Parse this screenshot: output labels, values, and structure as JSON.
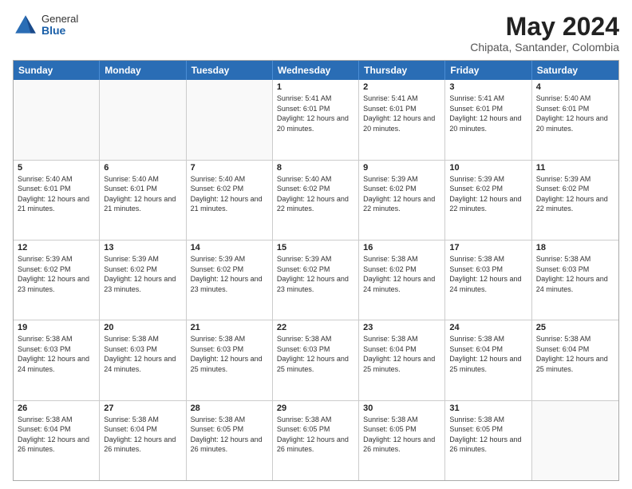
{
  "logo": {
    "general": "General",
    "blue": "Blue"
  },
  "title": "May 2024",
  "location": "Chipata, Santander, Colombia",
  "days_of_week": [
    "Sunday",
    "Monday",
    "Tuesday",
    "Wednesday",
    "Thursday",
    "Friday",
    "Saturday"
  ],
  "weeks": [
    [
      {
        "day": "",
        "sunrise": "",
        "sunset": "",
        "daylight": "",
        "empty": true
      },
      {
        "day": "",
        "sunrise": "",
        "sunset": "",
        "daylight": "",
        "empty": true
      },
      {
        "day": "",
        "sunrise": "",
        "sunset": "",
        "daylight": "",
        "empty": true
      },
      {
        "day": "1",
        "sunrise": "Sunrise: 5:41 AM",
        "sunset": "Sunset: 6:01 PM",
        "daylight": "Daylight: 12 hours and 20 minutes.",
        "empty": false
      },
      {
        "day": "2",
        "sunrise": "Sunrise: 5:41 AM",
        "sunset": "Sunset: 6:01 PM",
        "daylight": "Daylight: 12 hours and 20 minutes.",
        "empty": false
      },
      {
        "day": "3",
        "sunrise": "Sunrise: 5:41 AM",
        "sunset": "Sunset: 6:01 PM",
        "daylight": "Daylight: 12 hours and 20 minutes.",
        "empty": false
      },
      {
        "day": "4",
        "sunrise": "Sunrise: 5:40 AM",
        "sunset": "Sunset: 6:01 PM",
        "daylight": "Daylight: 12 hours and 20 minutes.",
        "empty": false
      }
    ],
    [
      {
        "day": "5",
        "sunrise": "Sunrise: 5:40 AM",
        "sunset": "Sunset: 6:01 PM",
        "daylight": "Daylight: 12 hours and 21 minutes.",
        "empty": false
      },
      {
        "day": "6",
        "sunrise": "Sunrise: 5:40 AM",
        "sunset": "Sunset: 6:01 PM",
        "daylight": "Daylight: 12 hours and 21 minutes.",
        "empty": false
      },
      {
        "day": "7",
        "sunrise": "Sunrise: 5:40 AM",
        "sunset": "Sunset: 6:02 PM",
        "daylight": "Daylight: 12 hours and 21 minutes.",
        "empty": false
      },
      {
        "day": "8",
        "sunrise": "Sunrise: 5:40 AM",
        "sunset": "Sunset: 6:02 PM",
        "daylight": "Daylight: 12 hours and 22 minutes.",
        "empty": false
      },
      {
        "day": "9",
        "sunrise": "Sunrise: 5:39 AM",
        "sunset": "Sunset: 6:02 PM",
        "daylight": "Daylight: 12 hours and 22 minutes.",
        "empty": false
      },
      {
        "day": "10",
        "sunrise": "Sunrise: 5:39 AM",
        "sunset": "Sunset: 6:02 PM",
        "daylight": "Daylight: 12 hours and 22 minutes.",
        "empty": false
      },
      {
        "day": "11",
        "sunrise": "Sunrise: 5:39 AM",
        "sunset": "Sunset: 6:02 PM",
        "daylight": "Daylight: 12 hours and 22 minutes.",
        "empty": false
      }
    ],
    [
      {
        "day": "12",
        "sunrise": "Sunrise: 5:39 AM",
        "sunset": "Sunset: 6:02 PM",
        "daylight": "Daylight: 12 hours and 23 minutes.",
        "empty": false
      },
      {
        "day": "13",
        "sunrise": "Sunrise: 5:39 AM",
        "sunset": "Sunset: 6:02 PM",
        "daylight": "Daylight: 12 hours and 23 minutes.",
        "empty": false
      },
      {
        "day": "14",
        "sunrise": "Sunrise: 5:39 AM",
        "sunset": "Sunset: 6:02 PM",
        "daylight": "Daylight: 12 hours and 23 minutes.",
        "empty": false
      },
      {
        "day": "15",
        "sunrise": "Sunrise: 5:39 AM",
        "sunset": "Sunset: 6:02 PM",
        "daylight": "Daylight: 12 hours and 23 minutes.",
        "empty": false
      },
      {
        "day": "16",
        "sunrise": "Sunrise: 5:38 AM",
        "sunset": "Sunset: 6:02 PM",
        "daylight": "Daylight: 12 hours and 24 minutes.",
        "empty": false
      },
      {
        "day": "17",
        "sunrise": "Sunrise: 5:38 AM",
        "sunset": "Sunset: 6:03 PM",
        "daylight": "Daylight: 12 hours and 24 minutes.",
        "empty": false
      },
      {
        "day": "18",
        "sunrise": "Sunrise: 5:38 AM",
        "sunset": "Sunset: 6:03 PM",
        "daylight": "Daylight: 12 hours and 24 minutes.",
        "empty": false
      }
    ],
    [
      {
        "day": "19",
        "sunrise": "Sunrise: 5:38 AM",
        "sunset": "Sunset: 6:03 PM",
        "daylight": "Daylight: 12 hours and 24 minutes.",
        "empty": false
      },
      {
        "day": "20",
        "sunrise": "Sunrise: 5:38 AM",
        "sunset": "Sunset: 6:03 PM",
        "daylight": "Daylight: 12 hours and 24 minutes.",
        "empty": false
      },
      {
        "day": "21",
        "sunrise": "Sunrise: 5:38 AM",
        "sunset": "Sunset: 6:03 PM",
        "daylight": "Daylight: 12 hours and 25 minutes.",
        "empty": false
      },
      {
        "day": "22",
        "sunrise": "Sunrise: 5:38 AM",
        "sunset": "Sunset: 6:03 PM",
        "daylight": "Daylight: 12 hours and 25 minutes.",
        "empty": false
      },
      {
        "day": "23",
        "sunrise": "Sunrise: 5:38 AM",
        "sunset": "Sunset: 6:04 PM",
        "daylight": "Daylight: 12 hours and 25 minutes.",
        "empty": false
      },
      {
        "day": "24",
        "sunrise": "Sunrise: 5:38 AM",
        "sunset": "Sunset: 6:04 PM",
        "daylight": "Daylight: 12 hours and 25 minutes.",
        "empty": false
      },
      {
        "day": "25",
        "sunrise": "Sunrise: 5:38 AM",
        "sunset": "Sunset: 6:04 PM",
        "daylight": "Daylight: 12 hours and 25 minutes.",
        "empty": false
      }
    ],
    [
      {
        "day": "26",
        "sunrise": "Sunrise: 5:38 AM",
        "sunset": "Sunset: 6:04 PM",
        "daylight": "Daylight: 12 hours and 26 minutes.",
        "empty": false
      },
      {
        "day": "27",
        "sunrise": "Sunrise: 5:38 AM",
        "sunset": "Sunset: 6:04 PM",
        "daylight": "Daylight: 12 hours and 26 minutes.",
        "empty": false
      },
      {
        "day": "28",
        "sunrise": "Sunrise: 5:38 AM",
        "sunset": "Sunset: 6:05 PM",
        "daylight": "Daylight: 12 hours and 26 minutes.",
        "empty": false
      },
      {
        "day": "29",
        "sunrise": "Sunrise: 5:38 AM",
        "sunset": "Sunset: 6:05 PM",
        "daylight": "Daylight: 12 hours and 26 minutes.",
        "empty": false
      },
      {
        "day": "30",
        "sunrise": "Sunrise: 5:38 AM",
        "sunset": "Sunset: 6:05 PM",
        "daylight": "Daylight: 12 hours and 26 minutes.",
        "empty": false
      },
      {
        "day": "31",
        "sunrise": "Sunrise: 5:38 AM",
        "sunset": "Sunset: 6:05 PM",
        "daylight": "Daylight: 12 hours and 26 minutes.",
        "empty": false
      },
      {
        "day": "",
        "sunrise": "",
        "sunset": "",
        "daylight": "",
        "empty": true
      }
    ]
  ]
}
